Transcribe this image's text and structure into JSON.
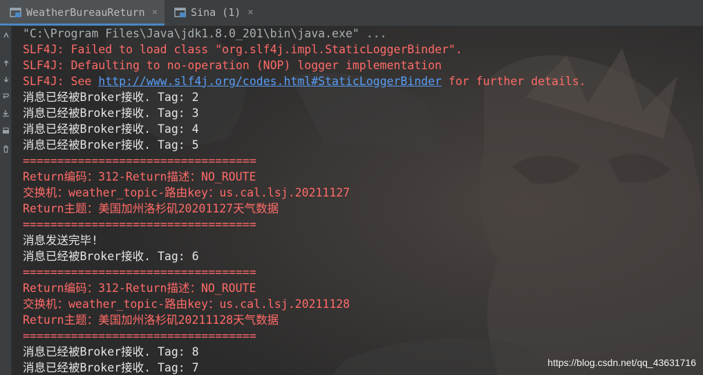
{
  "tabs": [
    {
      "label": "WeatherBureauReturn",
      "close": "×",
      "active": true
    },
    {
      "label": "Sina (1)",
      "close": "×",
      "active": false
    }
  ],
  "gutter_icons": [
    "restore-layout-icon",
    "up-arrow-icon",
    "down-arrow-icon",
    "soft-wrap-icon",
    "scroll-to-end-icon",
    "print-icon",
    "delete-icon"
  ],
  "console": {
    "lines": [
      {
        "text": "\"C:\\Program Files\\Java\\jdk1.8.0_201\\bin\\java.exe\" ...",
        "style": "gray"
      },
      {
        "text": "SLF4J: Failed to load class \"org.slf4j.impl.StaticLoggerBinder\".",
        "style": "red"
      },
      {
        "text": "SLF4J: Defaulting to no-operation (NOP) logger implementation",
        "style": "red"
      },
      {
        "text": "SLF4J: See ",
        "style": "red",
        "link": "http://www.slf4j.org/codes.html#StaticLoggerBinder",
        "suffix": " for further details."
      },
      {
        "text": "消息已经被Broker接收. Tag: 2",
        "style": "white"
      },
      {
        "text": "消息已经被Broker接收. Tag: 3",
        "style": "white"
      },
      {
        "text": "消息已经被Broker接收. Tag: 4",
        "style": "white"
      },
      {
        "text": "消息已经被Broker接收. Tag: 5",
        "style": "white"
      },
      {
        "text": "==================================",
        "style": "red"
      },
      {
        "text": "Return编码：312-Return描述：NO_ROUTE",
        "style": "red"
      },
      {
        "text": "交换机：weather_topic-路由key：us.cal.lsj.20211127",
        "style": "red"
      },
      {
        "text": "Return主题：美国加州洛杉矶20201127天气数据",
        "style": "red"
      },
      {
        "text": "==================================",
        "style": "red"
      },
      {
        "text": "消息发送完毕!",
        "style": "white"
      },
      {
        "text": "消息已经被Broker接收. Tag: 6",
        "style": "white"
      },
      {
        "text": "==================================",
        "style": "red"
      },
      {
        "text": "Return编码：312-Return描述：NO_ROUTE",
        "style": "red"
      },
      {
        "text": "交换机：weather_topic-路由key：us.cal.lsj.20211128",
        "style": "red"
      },
      {
        "text": "Return主题：美国加州洛杉矶20211128天气数据",
        "style": "red"
      },
      {
        "text": "==================================",
        "style": "red"
      },
      {
        "text": "消息已经被Broker接收. Tag: 8",
        "style": "white"
      },
      {
        "text": "消息已经被Broker接收. Tag: 7",
        "style": "white"
      }
    ]
  },
  "watermark": "https://blog.csdn.net/qq_43631716",
  "colors": {
    "background": "#2b2b2b",
    "error_text": "#ff6b68",
    "normal_text": "#e6e6e6",
    "command_text": "#a9b0b4",
    "link": "#589df6",
    "tab_accent": "#4a88c7"
  }
}
